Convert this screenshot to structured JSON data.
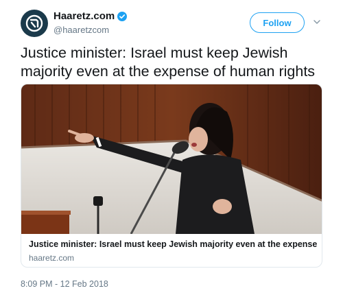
{
  "account": {
    "display_name": "Haaretz.com",
    "handle": "@haaretzcom",
    "verified": true,
    "avatar_icon": "haaretz-logo-icon",
    "avatar_color": "#1b3a4b"
  },
  "actions": {
    "follow_label": "Follow",
    "more_icon": "chevron-down-icon"
  },
  "tweet": {
    "text": "Justice minister: Israel must keep Jewish majority even at the expense of human rights"
  },
  "card": {
    "title": "Justice minister: Israel must keep Jewish majority even at the expense of hu...",
    "domain": "haaretz.com",
    "image": "photo-speaker-at-podium"
  },
  "meta": {
    "timestamp": "8:09 PM - 12 Feb 2018"
  },
  "colors": {
    "link_blue": "#1da1f2",
    "secondary_text": "#657786",
    "border": "#e1e8ed"
  }
}
